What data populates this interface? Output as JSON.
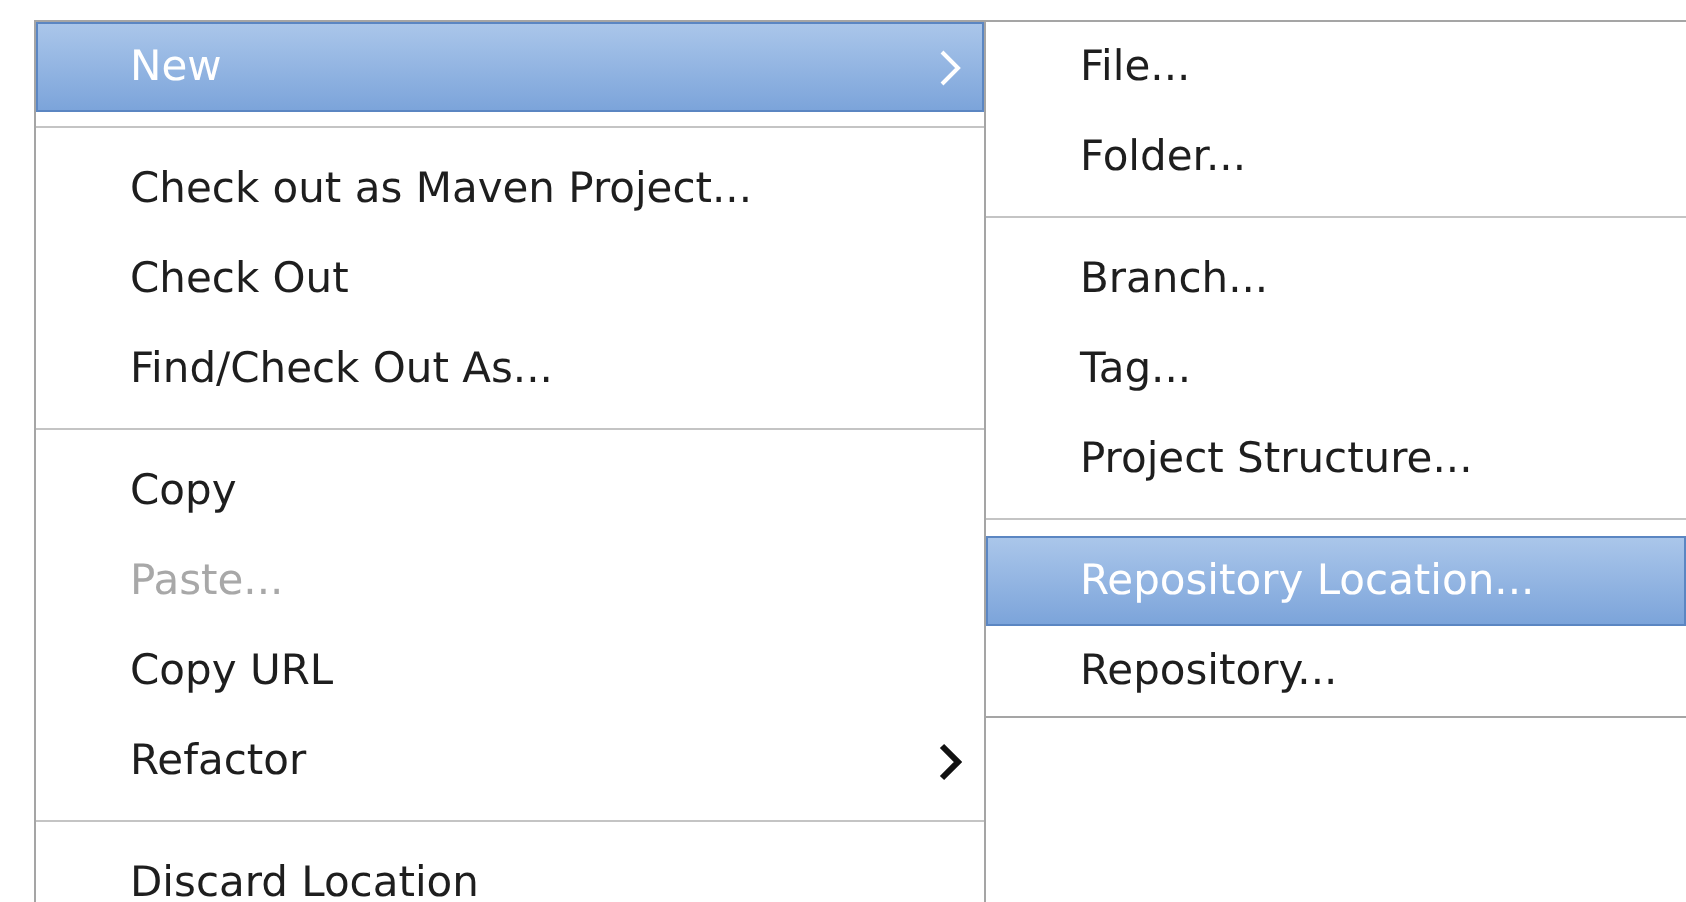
{
  "context_menu": {
    "items": [
      {
        "kind": "item",
        "label": "New",
        "selected": true,
        "disabled": false,
        "submenu": true
      },
      {
        "kind": "separator"
      },
      {
        "kind": "item",
        "label": "Check out as Maven Project...",
        "selected": false,
        "disabled": false,
        "submenu": false
      },
      {
        "kind": "item",
        "label": "Check Out",
        "selected": false,
        "disabled": false,
        "submenu": false
      },
      {
        "kind": "item",
        "label": "Find/Check Out As...",
        "selected": false,
        "disabled": false,
        "submenu": false
      },
      {
        "kind": "separator"
      },
      {
        "kind": "item",
        "label": "Copy",
        "selected": false,
        "disabled": false,
        "submenu": false
      },
      {
        "kind": "item",
        "label": "Paste...",
        "selected": false,
        "disabled": true,
        "submenu": false
      },
      {
        "kind": "item",
        "label": "Copy URL",
        "selected": false,
        "disabled": false,
        "submenu": false
      },
      {
        "kind": "item",
        "label": "Refactor",
        "selected": false,
        "disabled": false,
        "submenu": true
      },
      {
        "kind": "separator"
      },
      {
        "kind": "item",
        "label": "Discard Location",
        "selected": false,
        "disabled": false,
        "submenu": false
      }
    ]
  },
  "submenu": {
    "items": [
      {
        "kind": "item",
        "label": "File...",
        "selected": false,
        "disabled": false,
        "submenu": false
      },
      {
        "kind": "item",
        "label": "Folder...",
        "selected": false,
        "disabled": false,
        "submenu": false
      },
      {
        "kind": "separator"
      },
      {
        "kind": "item",
        "label": "Branch...",
        "selected": false,
        "disabled": false,
        "submenu": false
      },
      {
        "kind": "item",
        "label": "Tag...",
        "selected": false,
        "disabled": false,
        "submenu": false
      },
      {
        "kind": "item",
        "label": "Project Structure...",
        "selected": false,
        "disabled": false,
        "submenu": false
      },
      {
        "kind": "separator"
      },
      {
        "kind": "item",
        "label": "Repository Location...",
        "selected": true,
        "disabled": false,
        "submenu": false
      },
      {
        "kind": "item",
        "label": "Repository...",
        "selected": false,
        "disabled": false,
        "submenu": false
      }
    ]
  }
}
